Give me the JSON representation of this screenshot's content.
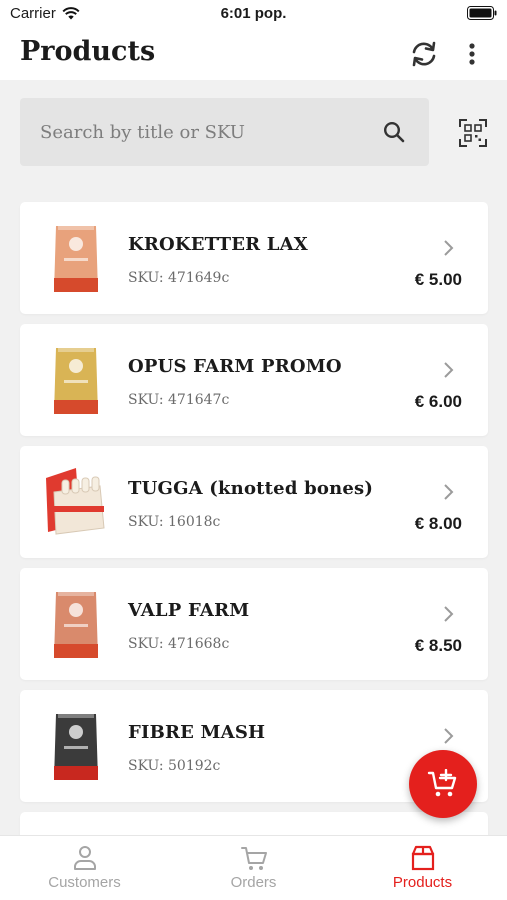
{
  "status": {
    "carrier": "Carrier",
    "time": "6:01 pop."
  },
  "header": {
    "title": "Products"
  },
  "search": {
    "placeholder": "Search by title or SKU"
  },
  "products": [
    {
      "name": "KROKETTER LAX",
      "sku": "SKU: 471649c",
      "price": "€ 5.00",
      "thumb": "bag",
      "colors": [
        "#e8a27c",
        "#d64a2c"
      ]
    },
    {
      "name": "OPUS FARM PROMO",
      "sku": "SKU: 471647c",
      "price": "€ 6.00",
      "thumb": "bag",
      "colors": [
        "#d9b455",
        "#d64a2c"
      ]
    },
    {
      "name": "TUGGA (knotted bones)",
      "sku": "SKU: 16018c",
      "price": "€ 8.00",
      "thumb": "box",
      "colors": [
        "#e03a2f",
        "#f2e7d8"
      ]
    },
    {
      "name": "VALP FARM",
      "sku": "SKU: 471668c",
      "price": "€ 8.50",
      "thumb": "bag",
      "colors": [
        "#d98a6c",
        "#d64a2c"
      ]
    },
    {
      "name": "FIBRE MASH",
      "sku": "SKU: 50192c",
      "price": "",
      "thumb": "bag",
      "colors": [
        "#3b3b3b",
        "#c8281f"
      ]
    }
  ],
  "tabs": [
    {
      "label": "Customers",
      "icon": "person-icon",
      "active": false
    },
    {
      "label": "Orders",
      "icon": "cart-icon",
      "active": false
    },
    {
      "label": "Products",
      "icon": "box-icon",
      "active": true
    }
  ],
  "colors": {
    "accent": "#e4201d",
    "inactive": "#a5a5a5"
  }
}
